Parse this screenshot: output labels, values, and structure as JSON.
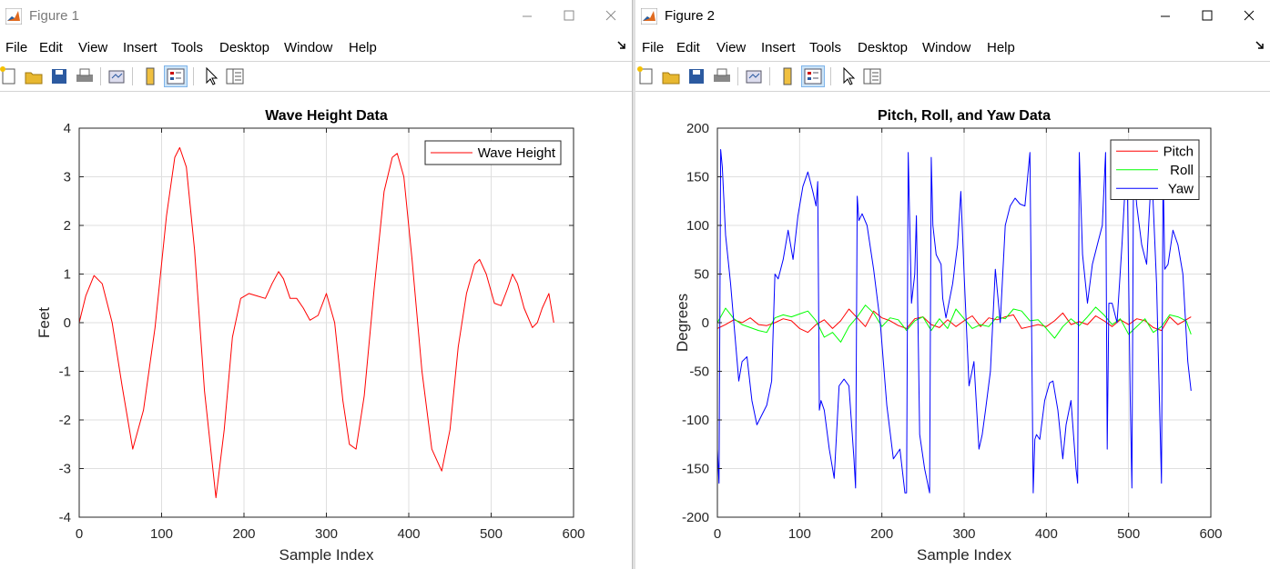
{
  "windows": [
    {
      "title": "Figure 1",
      "menu": [
        "File",
        "Edit",
        "View",
        "Insert",
        "Tools",
        "Desktop",
        "Window",
        "Help"
      ]
    },
    {
      "title": "Figure 2",
      "menu": [
        "File",
        "Edit",
        "View",
        "Insert",
        "Tools",
        "Desktop",
        "Window",
        "Help"
      ]
    }
  ],
  "toolbar_icons": [
    "new-figure-icon",
    "open-file-icon",
    "save-icon",
    "print-icon",
    "link-plot-icon",
    "colorbar-icon",
    "legend-icon",
    "pointer-icon",
    "property-inspector-icon"
  ],
  "chart_data": [
    {
      "type": "line",
      "title": "Wave Height Data",
      "xlabel": "Sample Index",
      "ylabel": "Feet",
      "xlim": [
        0,
        600
      ],
      "ylim": [
        -4,
        4
      ],
      "xticks": [
        0,
        100,
        200,
        300,
        400,
        500,
        600
      ],
      "yticks": [
        -4,
        -3,
        -2,
        -1,
        0,
        1,
        2,
        3,
        4
      ],
      "grid": true,
      "legend": "top-right",
      "series": [
        {
          "name": "Wave Height",
          "color": "#ff0000",
          "x": [
            0,
            8,
            18,
            28,
            40,
            52,
            65,
            78,
            92,
            106,
            116,
            122,
            130,
            140,
            152,
            166,
            176,
            186,
            196,
            206,
            216,
            226,
            234,
            242,
            248,
            256,
            264,
            272,
            280,
            290,
            300,
            310,
            320,
            328,
            336,
            346,
            358,
            370,
            380,
            386,
            394,
            404,
            416,
            428,
            440,
            450,
            460,
            470,
            480,
            486,
            494,
            504,
            512,
            520,
            526,
            532,
            540,
            550,
            556,
            562,
            570,
            576
          ],
          "y": [
            0,
            0.55,
            0.97,
            0.8,
            0,
            -1.3,
            -2.6,
            -1.8,
            -0.1,
            2.2,
            3.4,
            3.6,
            3.2,
            1.5,
            -1.4,
            -3.6,
            -2.2,
            -0.3,
            0.5,
            0.6,
            0.55,
            0.5,
            0.8,
            1.05,
            0.9,
            0.5,
            0.5,
            0.3,
            0.05,
            0.15,
            0.6,
            0,
            -1.6,
            -2.5,
            -2.6,
            -1.5,
            0.7,
            2.7,
            3.4,
            3.48,
            3,
            1.3,
            -1.0,
            -2.6,
            -3.05,
            -2.2,
            -0.5,
            0.6,
            1.2,
            1.3,
            1.0,
            0.4,
            0.35,
            0.7,
            1.0,
            0.8,
            0.3,
            -0.1,
            0,
            0.3,
            0.6,
            0
          ]
        }
      ]
    },
    {
      "type": "line",
      "title": "Pitch, Roll, and Yaw Data",
      "xlabel": "Sample Index",
      "ylabel": "Degrees",
      "xlim": [
        0,
        600
      ],
      "ylim": [
        -200,
        200
      ],
      "xticks": [
        0,
        100,
        200,
        300,
        400,
        500,
        600
      ],
      "yticks": [
        -200,
        -150,
        -100,
        -50,
        0,
        50,
        100,
        150,
        200
      ],
      "grid": true,
      "legend": "top-right",
      "series": [
        {
          "name": "Pitch",
          "color": "#ff0000",
          "x": [
            0,
            10,
            20,
            30,
            40,
            50,
            60,
            70,
            80,
            90,
            100,
            110,
            120,
            130,
            140,
            150,
            160,
            170,
            180,
            190,
            200,
            210,
            220,
            230,
            240,
            250,
            260,
            270,
            280,
            290,
            300,
            310,
            320,
            330,
            340,
            350,
            360,
            370,
            380,
            390,
            400,
            410,
            420,
            430,
            440,
            450,
            460,
            470,
            480,
            490,
            500,
            510,
            520,
            530,
            540,
            550,
            560,
            570,
            576
          ],
          "y": [
            -6,
            -2,
            3,
            0,
            5,
            -2,
            -3,
            0,
            4,
            2,
            -6,
            -10,
            -2,
            3,
            -6,
            2,
            14,
            5,
            -4,
            12,
            5,
            2,
            -3,
            -6,
            4,
            6,
            -2,
            -5,
            3,
            -4,
            2,
            7,
            -4,
            5,
            3,
            6,
            8,
            -6,
            -4,
            -2,
            -4,
            2,
            10,
            -2,
            1,
            -2,
            7,
            2,
            -4,
            3,
            -2,
            4,
            2,
            -5,
            -8,
            6,
            -2,
            3,
            6
          ]
        },
        {
          "name": "Roll",
          "color": "#00ff00",
          "x": [
            0,
            10,
            20,
            30,
            40,
            50,
            60,
            70,
            80,
            90,
            100,
            110,
            120,
            130,
            140,
            150,
            160,
            170,
            180,
            190,
            200,
            210,
            220,
            230,
            240,
            250,
            260,
            270,
            280,
            290,
            300,
            310,
            320,
            330,
            340,
            350,
            360,
            370,
            380,
            390,
            400,
            410,
            420,
            430,
            440,
            450,
            460,
            470,
            480,
            490,
            500,
            510,
            520,
            530,
            540,
            550,
            560,
            570,
            576
          ],
          "y": [
            0,
            15,
            4,
            -2,
            -5,
            -8,
            -10,
            5,
            8,
            6,
            9,
            12,
            2,
            -15,
            -10,
            -20,
            -4,
            6,
            18,
            10,
            -4,
            5,
            3,
            -8,
            2,
            6,
            -8,
            4,
            -6,
            14,
            4,
            -6,
            -2,
            -4,
            6,
            4,
            14,
            12,
            2,
            3,
            -6,
            -16,
            -4,
            4,
            -3,
            6,
            16,
            8,
            -2,
            4,
            -12,
            -4,
            4,
            -10,
            -4,
            8,
            6,
            2,
            -12
          ]
        },
        {
          "name": "Yaw",
          "color": "#0000ff",
          "x": [
            0,
            2,
            4,
            6,
            10,
            16,
            22,
            26,
            30,
            36,
            42,
            48,
            54,
            60,
            66,
            70,
            74,
            80,
            86,
            92,
            98,
            104,
            110,
            116,
            120,
            122,
            124,
            126,
            130,
            136,
            142,
            148,
            154,
            160,
            166,
            168,
            170,
            172,
            176,
            182,
            190,
            198,
            206,
            214,
            222,
            228,
            230,
            232,
            236,
            240,
            242,
            246,
            252,
            258,
            260,
            262,
            266,
            272,
            274,
            278,
            286,
            292,
            296,
            300,
            306,
            312,
            318,
            322,
            326,
            332,
            338,
            344,
            350,
            356,
            362,
            368,
            374,
            380,
            384,
            386,
            388,
            392,
            398,
            404,
            408,
            414,
            420,
            424,
            430,
            436,
            438,
            440,
            444,
            450,
            456,
            462,
            468,
            472,
            474,
            476,
            480,
            486,
            492,
            498,
            502,
            504,
            506,
            510,
            516,
            522,
            528,
            534,
            540,
            542,
            544,
            548,
            554,
            560,
            566,
            572,
            576
          ],
          "y": [
            -130,
            -165,
            178,
            160,
            90,
            40,
            -20,
            -60,
            -40,
            -35,
            -80,
            -105,
            -95,
            -85,
            -60,
            50,
            45,
            65,
            95,
            65,
            110,
            140,
            155,
            135,
            120,
            145,
            -90,
            -80,
            -90,
            -130,
            -160,
            -65,
            -58,
            -65,
            -140,
            -170,
            130,
            105,
            112,
            100,
            55,
            0,
            -85,
            -140,
            -130,
            -175,
            -175,
            175,
            20,
            50,
            110,
            -115,
            -150,
            -175,
            170,
            100,
            70,
            60,
            25,
            5,
            40,
            80,
            135,
            50,
            -65,
            -40,
            -130,
            -115,
            -90,
            -50,
            55,
            0,
            100,
            120,
            128,
            122,
            120,
            175,
            -175,
            -120,
            -115,
            -120,
            -80,
            -62,
            -60,
            -90,
            -140,
            -105,
            -80,
            -150,
            -165,
            175,
            70,
            20,
            60,
            80,
            100,
            175,
            -130,
            20,
            20,
            0,
            80,
            175,
            -80,
            -170,
            160,
            120,
            80,
            60,
            160,
            40,
            -165,
            160,
            55,
            60,
            95,
            80,
            50,
            -40,
            -70
          ]
        }
      ]
    }
  ]
}
